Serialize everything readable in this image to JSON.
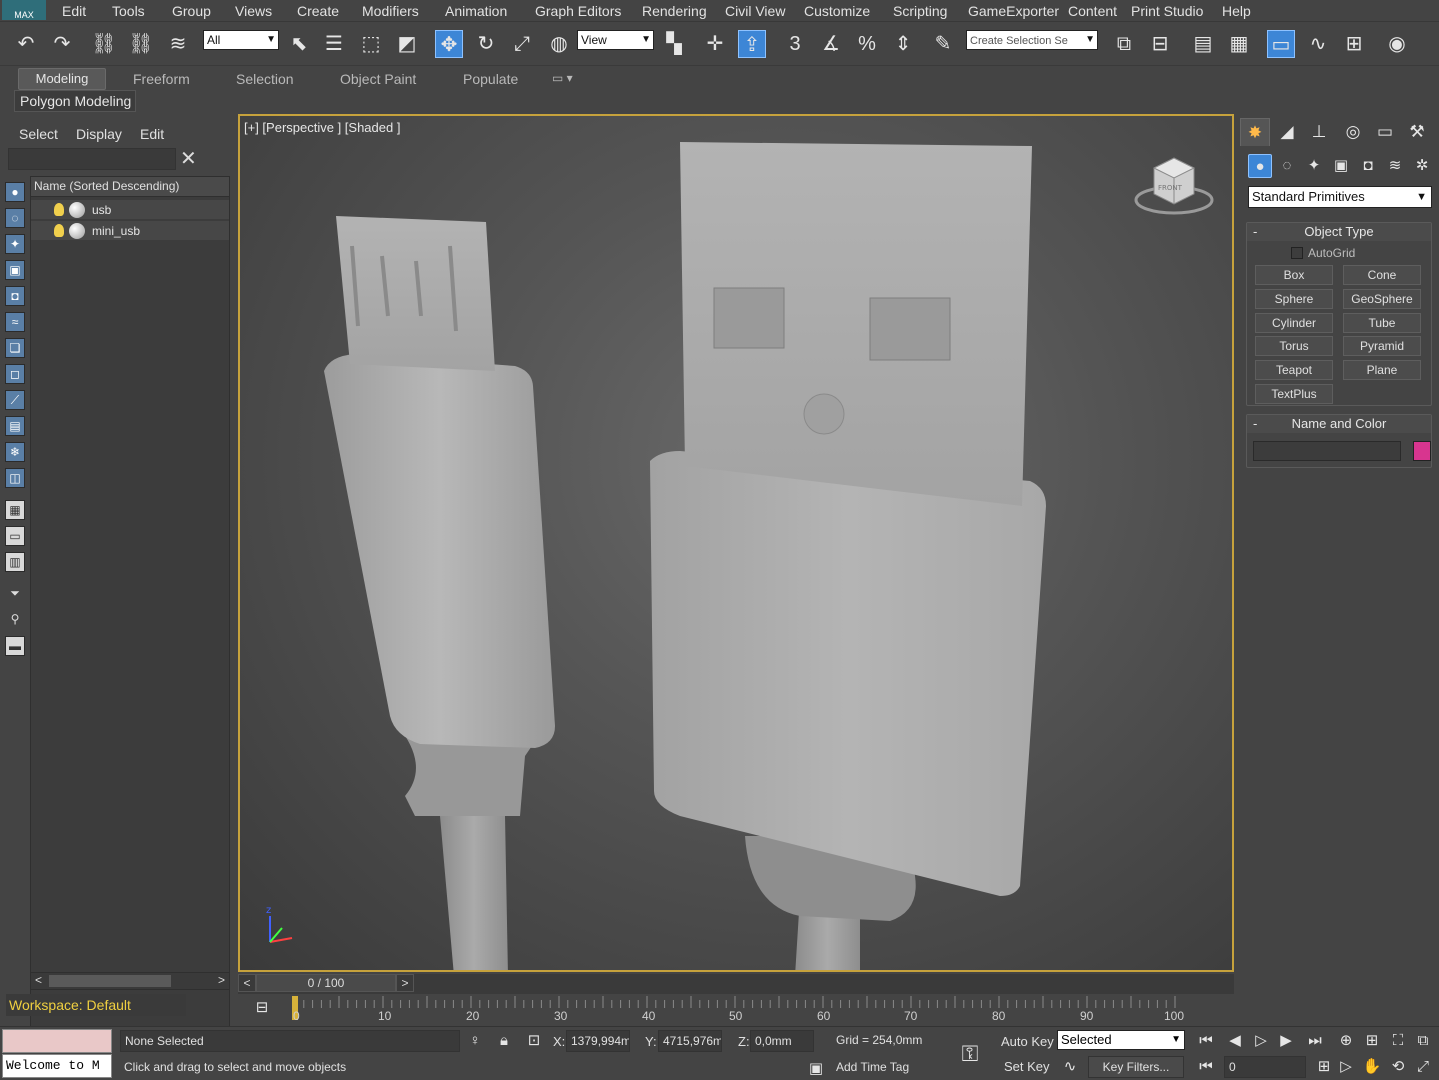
{
  "app": {
    "logo_label": "MAX"
  },
  "menubar": {
    "items": [
      "Edit",
      "Tools",
      "Group",
      "Views",
      "Create",
      "Modifiers",
      "Animation",
      "Graph Editors",
      "Rendering",
      "Civil View",
      "Customize",
      "Scripting",
      "GameExporter",
      "Content",
      "Print Studio",
      "Help"
    ]
  },
  "toolbar": {
    "selection_filter": "All",
    "ref_coord": "View",
    "snap_label": "3",
    "named_selection_placeholder": "Create Selection Se",
    "accent_color": "#3d86d6"
  },
  "ribbon": {
    "tabs": [
      "Modeling",
      "Freeform",
      "Selection",
      "Object Paint",
      "Populate"
    ],
    "active_tab": "Modeling",
    "panel_label": "Polygon Modeling"
  },
  "explorer": {
    "menu": [
      "Select",
      "Display",
      "Edit"
    ],
    "column_header": "Name (Sorted Descending)",
    "rows": [
      {
        "name": "usb"
      },
      {
        "name": "mini_usb"
      }
    ],
    "workspace": "Workspace: Default"
  },
  "viewport": {
    "label": "[+] [Perspective ] [Shaded ]",
    "viewcube_label": "FRONT",
    "border_color": "#c6a23c"
  },
  "timeslider": {
    "frame_label": "0 / 100",
    "prev": "<",
    "next": ">"
  },
  "trackbar": {
    "ticks": [
      "0",
      "10",
      "20",
      "30",
      "40",
      "50",
      "60",
      "70",
      "80",
      "90",
      "100"
    ]
  },
  "statusbar": {
    "listener_text": "Welcome to M",
    "selection_status": "None Selected",
    "prompt": "Click and drag to select and move objects",
    "x_label": "X:",
    "x_value": "1379,994mi",
    "y_label": "Y:",
    "y_value": "4715,976m",
    "z_label": "Z:",
    "z_value": "0,0mm",
    "grid": "Grid = 254,0mm",
    "add_time_tag": "Add Time Tag",
    "auto_key": "Auto Key",
    "set_key": "Set Key",
    "key_mode": "Selected",
    "key_filters": "Key Filters...",
    "current_frame": "0"
  },
  "command_panel": {
    "category": "Standard Primitives",
    "object_type_title": "Object Type",
    "autogrid_label": "AutoGrid",
    "primitives": [
      "Box",
      "Cone",
      "Sphere",
      "GeoSphere",
      "Cylinder",
      "Tube",
      "Torus",
      "Pyramid",
      "Teapot",
      "Plane",
      "TextPlus"
    ],
    "name_color_title": "Name and Color",
    "object_color": "#d8358f"
  }
}
